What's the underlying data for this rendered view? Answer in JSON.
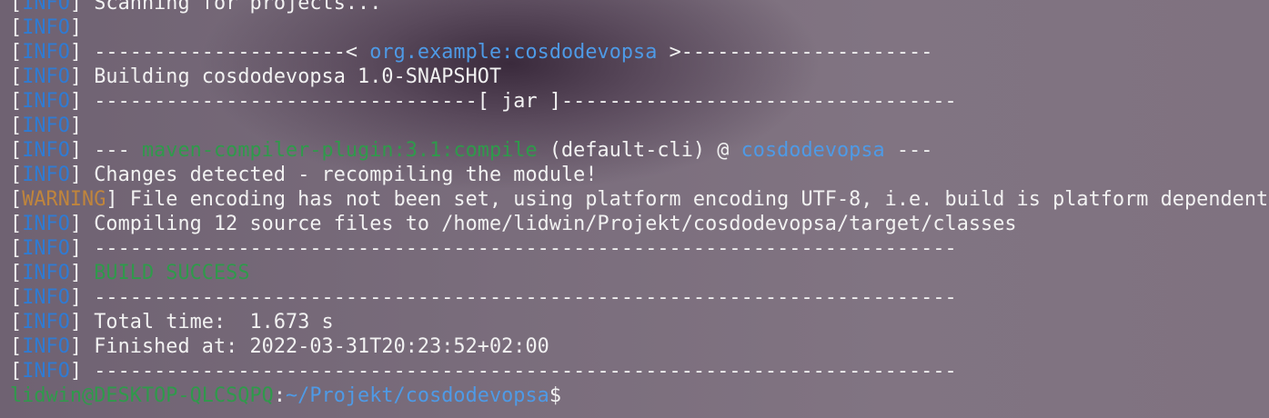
{
  "terminal": {
    "lines": [
      {
        "level": "INFO",
        "text": " Scanning for projects..."
      },
      {
        "level": "INFO",
        "text": ""
      },
      {
        "level": "INFO",
        "text_pre": " ---------------------< ",
        "text_link": "org.example:cosdodevopsa",
        "text_post": " >---------------------"
      },
      {
        "level": "INFO",
        "text": " Building cosdodevopsa 1.0-SNAPSHOT"
      },
      {
        "level": "INFO",
        "text": " --------------------------------[ jar ]---------------------------------"
      },
      {
        "level": "INFO",
        "text": ""
      },
      {
        "level": "INFO",
        "text_pre": " --- ",
        "text_plugin": "maven-compiler-plugin:3.1:compile",
        "text_mid": " (default-cli) @ ",
        "text_project": "cosdodevopsa",
        "text_post": " ---"
      },
      {
        "level": "INFO",
        "text": " Changes detected - recompiling the module!"
      },
      {
        "level": "WARNING",
        "text": " File encoding has not been set, using platform encoding UTF-8, i.e. build is platform dependent!"
      },
      {
        "level": "INFO",
        "text": " Compiling 12 source files to /home/lidwin/Projekt/cosdodevopsa/target/classes"
      },
      {
        "level": "INFO",
        "text": " ------------------------------------------------------------------------"
      },
      {
        "level": "INFO",
        "text_success": " BUILD SUCCESS"
      },
      {
        "level": "INFO",
        "text": " ------------------------------------------------------------------------"
      },
      {
        "level": "INFO",
        "text": " Total time:  1.673 s"
      },
      {
        "level": "INFO",
        "text": " Finished at: 2022-03-31T20:23:52+02:00"
      },
      {
        "level": "INFO",
        "text": " ------------------------------------------------------------------------"
      }
    ],
    "prompt": {
      "user_host": "lidwin@DESKTOP-QLCSQPQ",
      "separator": ":",
      "path": "~/Projekt/cosdodevopsa",
      "symbol": "$"
    }
  },
  "colors": {
    "info": "#2f7bd3",
    "warning": "#c0853c",
    "success": "#2f9a4b",
    "highlight": "#4e9ae6",
    "text": "#f2f2f2"
  }
}
